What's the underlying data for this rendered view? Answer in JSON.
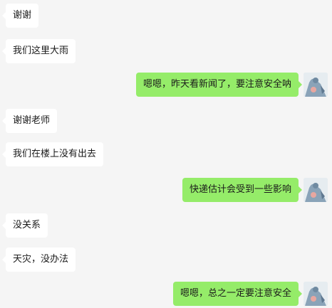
{
  "messages": [
    {
      "side": "in",
      "text": "谢谢"
    },
    {
      "side": "in",
      "text": "我们这里大雨"
    },
    {
      "side": "out",
      "text": "嗯嗯，昨天看新闻了，要注意安全呐"
    },
    {
      "side": "in",
      "text": "谢谢老师"
    },
    {
      "side": "in",
      "text": "我们在楼上没有出去"
    },
    {
      "side": "out",
      "text": "快递估计会受到一些影响"
    },
    {
      "side": "in",
      "text": "没关系"
    },
    {
      "side": "in",
      "text": "天灾，没办法"
    },
    {
      "side": "out",
      "text": "嗯嗯，总之一定要注意安全"
    }
  ],
  "colors": {
    "background": "#f5f5f5",
    "incoming_bubble": "#ffffff",
    "outgoing_bubble": "#95ec69"
  },
  "avatar_icon": "cartoon-character-avatar-icon"
}
